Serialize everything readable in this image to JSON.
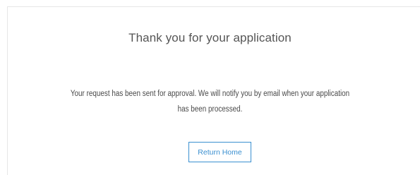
{
  "confirmation": {
    "title": "Thank you for your application",
    "message": "Your request has been sent for approval. We will notify you by email when your application has been processed.",
    "return_home_label": "Return Home"
  },
  "colors": {
    "accent": "#3a8fd0",
    "text": "#4a4a4a",
    "border": "#e6e6e6"
  }
}
